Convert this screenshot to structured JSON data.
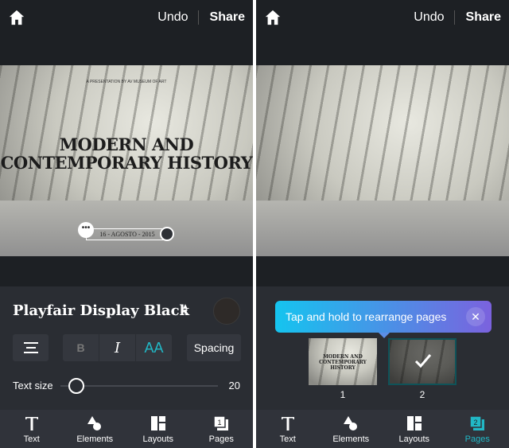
{
  "left": {
    "header": {
      "undo": "Undo",
      "share": "Share"
    },
    "canvas": {
      "presenter": "A PRESENTATION BY AV MUSEUM OF ART",
      "title": "MODERN AND CONTEMPORARY HISTORY",
      "date": "16 - AGOSTO - 2015",
      "more": "•••"
    },
    "panel": {
      "font_name": "Playfair Display Black",
      "bold": "B",
      "italic": "I",
      "caps": "AA",
      "spacing": "Spacing",
      "text_size_label": "Text size",
      "text_size_value": "20"
    },
    "tabs": [
      {
        "label": "Text"
      },
      {
        "label": "Elements"
      },
      {
        "label": "Layouts"
      },
      {
        "label": "Pages",
        "badge": "1"
      }
    ]
  },
  "right": {
    "header": {
      "undo": "Undo",
      "share": "Share"
    },
    "toast": {
      "message": "Tap and hold to rearrange pages",
      "close": "✕"
    },
    "pages": [
      {
        "number": "1",
        "selected": false,
        "mini_title": "MODERN AND CONTEMPORARY HISTORY"
      },
      {
        "number": "2",
        "selected": true
      }
    ],
    "tabs": [
      {
        "label": "Text"
      },
      {
        "label": "Elements"
      },
      {
        "label": "Layouts"
      },
      {
        "label": "Pages",
        "badge": "2",
        "active": true
      }
    ]
  },
  "colors": {
    "accent": "#21b8c6",
    "background": "#1d2024",
    "panel": "#2a2d33"
  }
}
